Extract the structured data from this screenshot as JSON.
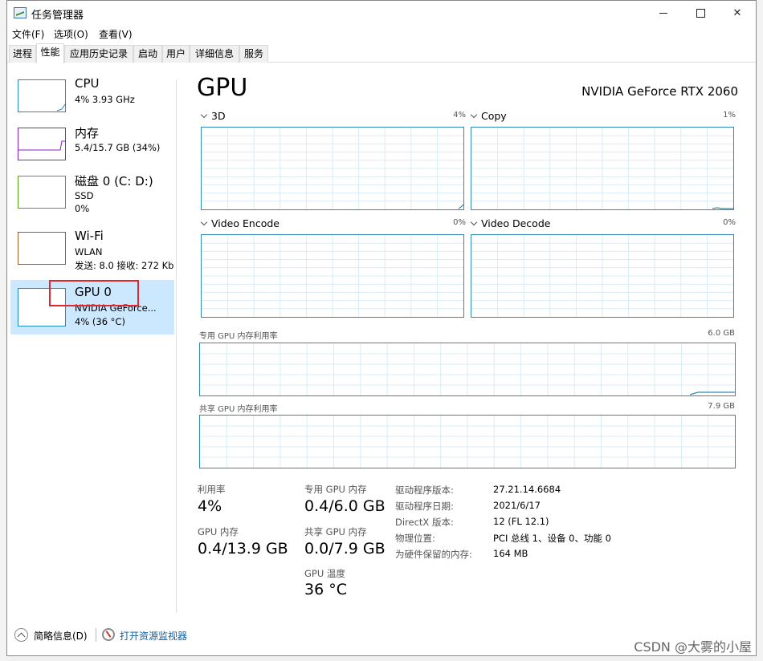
{
  "window": {
    "title": "任务管理器"
  },
  "menu": [
    "文件(F)",
    "选项(O)",
    "查看(V)"
  ],
  "tabs": [
    "进程",
    "性能",
    "应用历史记录",
    "启动",
    "用户",
    "详细信息",
    "服务"
  ],
  "active_tab": 1,
  "sidebar": [
    {
      "title": "CPU",
      "line1": "4% 3.93 GHz",
      "line2": "",
      "color": "#1f8bc6"
    },
    {
      "title": "内存",
      "line1": "5.4/15.7 GB (34%)",
      "line2": "",
      "color": "#8b1ec4"
    },
    {
      "title": "磁盘 0 (C: D:)",
      "line1": "SSD",
      "line2": "0%",
      "color": "#4da60c"
    },
    {
      "title": "Wi-Fi",
      "line1": "WLAN",
      "line2": "发送: 8.0 接收: 272 Kb",
      "color": "#a75a1e"
    },
    {
      "title": "GPU 0",
      "line1": "NVIDIA GeForce...",
      "line2": "4% (36 °C)",
      "color": "#1f8bc6"
    }
  ],
  "selected_item": 4,
  "main": {
    "heading": "GPU",
    "model": "NVIDIA GeForce RTX 2060",
    "engines": [
      {
        "name": "3D",
        "pct": "4%"
      },
      {
        "name": "Copy",
        "pct": "1%"
      },
      {
        "name": "Video Encode",
        "pct": "0%"
      },
      {
        "name": "Video Decode",
        "pct": "0%"
      }
    ],
    "dedicated": {
      "label": "专用 GPU 内存利用率",
      "value": "6.0 GB"
    },
    "shared": {
      "label": "共享 GPU 内存利用率",
      "value": "7.9 GB"
    },
    "stats": {
      "util_label": "利用率",
      "util_value": "4%",
      "gpumem_label": "GPU 内存",
      "gpumem_value": "0.4/13.9 GB",
      "dedmem_label": "专用 GPU 内存",
      "dedmem_value": "0.4/6.0 GB",
      "sharedmem_label": "共享 GPU 内存",
      "sharedmem_value": "0.0/7.9 GB",
      "temp_label": "GPU 温度",
      "temp_value": "36 °C"
    },
    "info": [
      {
        "key": "驱动程序版本:",
        "value": "27.21.14.6684"
      },
      {
        "key": "驱动程序日期:",
        "value": "2021/6/17"
      },
      {
        "key": "DirectX 版本:",
        "value": "12 (FL 12.1)"
      },
      {
        "key": "物理位置:",
        "value": "PCI 总线 1、设备 0、功能 0"
      },
      {
        "key": "为硬件保留的内存:",
        "value": "164 MB"
      }
    ]
  },
  "footer": {
    "fewer_details": "简略信息(D)",
    "open_monitor": "打开资源监视器"
  },
  "watermark": "CSDN @大雾的小屋",
  "colors": {
    "accent": "#2e8bb8",
    "selection": "#cce8ff",
    "highlight_box": "#e3262b"
  }
}
